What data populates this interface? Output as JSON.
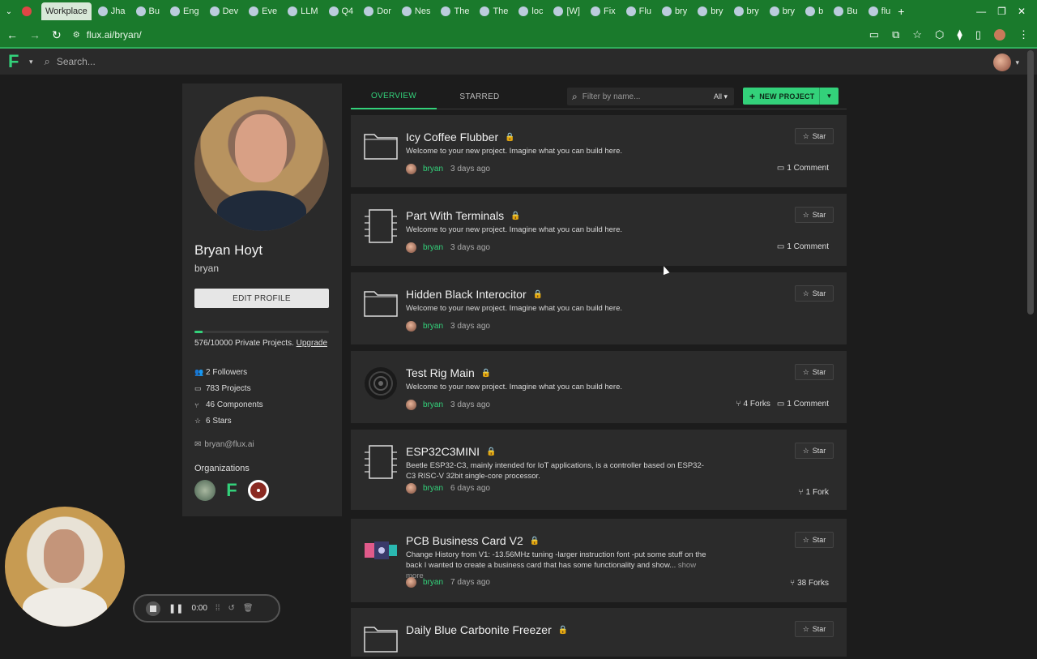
{
  "browser": {
    "tabs": [
      {
        "label": "",
        "icon": "recording-icon"
      },
      {
        "label": "Workplace",
        "active": true
      },
      {
        "label": "Jha"
      },
      {
        "label": "Bu"
      },
      {
        "label": "Eng"
      },
      {
        "label": "Dev"
      },
      {
        "label": "Eve"
      },
      {
        "label": "LLM"
      },
      {
        "label": "Q4"
      },
      {
        "label": "Dor"
      },
      {
        "label": "Nes"
      },
      {
        "label": "The"
      },
      {
        "label": "The"
      },
      {
        "label": "loc"
      },
      {
        "label": "[W]"
      },
      {
        "label": "Fix"
      },
      {
        "label": "Flu"
      },
      {
        "label": "bry"
      },
      {
        "label": "bry"
      },
      {
        "label": "bry"
      },
      {
        "label": "bry"
      },
      {
        "label": "b"
      },
      {
        "label": "Bu"
      },
      {
        "label": "flu"
      }
    ],
    "url": "flux.ai/bryan/",
    "colors": {
      "chrome": "#1a7a2c",
      "accent": "#33d17a"
    }
  },
  "app": {
    "search_placeholder": "Search..."
  },
  "profile": {
    "name": "Bryan Hoyt",
    "username": "bryan",
    "edit_label": "EDIT PROFILE",
    "quota_used": 576,
    "quota_total": 10000,
    "quota_text": "576/10000 Private Projects.",
    "upgrade_label": "Upgrade",
    "followers": "2 Followers",
    "projects": "783 Projects",
    "components": "46 Components",
    "stars": "6 Stars",
    "email": "bryan@flux.ai",
    "orgs_heading": "Organizations"
  },
  "main": {
    "tabs": [
      "OVERVIEW",
      "STARRED"
    ],
    "filter_placeholder": "Filter by name...",
    "filter_scope": "All",
    "new_project_label": "NEW PROJECT",
    "star_label": "Star",
    "projects": [
      {
        "title": "Icy Coffee Flubber",
        "desc": "Welcome to your new project. Imagine what you can build here.",
        "user": "bryan",
        "time": "3 days ago",
        "forks": "",
        "comments": "1 Comment",
        "thumb": "folder-icon"
      },
      {
        "title": "Part With Terminals",
        "desc": "Welcome to your new project. Imagine what you can build here.",
        "user": "bryan",
        "time": "3 days ago",
        "forks": "",
        "comments": "1 Comment",
        "thumb": "chip-icon"
      },
      {
        "title": "Hidden Black Interocitor",
        "desc": "Welcome to your new project. Imagine what you can build here.",
        "user": "bryan",
        "time": "3 days ago",
        "forks": "",
        "comments": "",
        "thumb": "folder-icon"
      },
      {
        "title": "Test Rig Main",
        "desc": "Welcome to your new project. Imagine what you can build here.",
        "user": "bryan",
        "time": "3 days ago",
        "forks": "4 Forks",
        "comments": "1 Comment",
        "thumb": "spiral-icon"
      },
      {
        "title": "ESP32C3MINI",
        "desc": "Beetle ESP32-C3, mainly intended for IoT applications, is a controller based on ESP32-C3 RISC-V 32bit single-core processor.",
        "user": "bryan",
        "time": "6 days ago",
        "forks": "1 Fork",
        "comments": "",
        "thumb": "chip-icon"
      },
      {
        "title": "PCB Business Card V2",
        "desc": "Change History from V1: -13.56MHz tuning -larger instruction font -put some stuff on the back I wanted to create a business card that has some functionality and show...",
        "more": "show more",
        "user": "bryan",
        "time": "7 days ago",
        "forks": "38 Forks",
        "comments": "",
        "thumb": "pcb-icon"
      },
      {
        "title": "Daily Blue Carbonite Freezer",
        "desc": "",
        "user": "",
        "time": "",
        "forks": "",
        "comments": "",
        "thumb": "folder-icon"
      }
    ]
  },
  "recorder": {
    "time": "0:00"
  }
}
